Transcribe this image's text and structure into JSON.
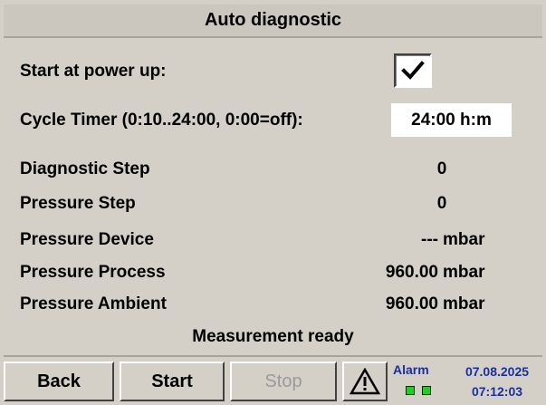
{
  "title": "Auto diagnostic",
  "start_at_power_up": {
    "label": "Start at power up:",
    "checked": true
  },
  "cycle_timer": {
    "label": "Cycle Timer (0:10..24:00, 0:00=off):",
    "value": "24:00 h:m"
  },
  "diagnostic_step": {
    "label": "Diagnostic Step",
    "value": "0"
  },
  "pressure_step": {
    "label": "Pressure Step",
    "value": "0"
  },
  "pressure_device": {
    "label": "Pressure Device",
    "value": "---",
    "unit": "mbar"
  },
  "pressure_process": {
    "label": "Pressure Process",
    "value": "960.00",
    "unit": "mbar"
  },
  "pressure_ambient": {
    "label": "Pressure Ambient",
    "value": "960.00",
    "unit": "mbar"
  },
  "status_text": "Measurement ready",
  "buttons": {
    "back": "Back",
    "start": "Start",
    "stop": "Stop"
  },
  "alarm": {
    "label": "Alarm",
    "led_color": "#22cc22"
  },
  "datetime": {
    "date": "07.08.2025",
    "time": "07:12:03"
  },
  "colors": {
    "background": "#d4d0c8",
    "accent_text": "#1a2fa0"
  },
  "icons": {
    "warning": "warning-triangle-icon",
    "checkbox": "checkmark-icon"
  }
}
